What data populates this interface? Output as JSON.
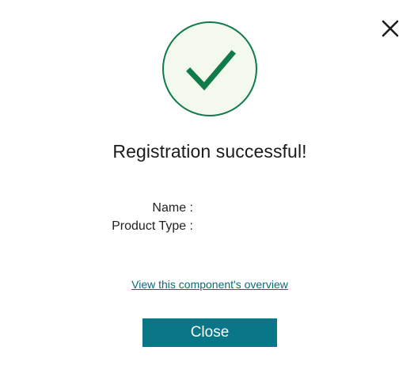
{
  "dialog": {
    "title": "Registration successful!",
    "fields": {
      "name_label": "Name :",
      "product_type_label": "Product Type :"
    },
    "overview_link": "View this component's overview",
    "close_button": "Close",
    "icons": {
      "close": "close-icon",
      "success": "checkmark-icon"
    },
    "colors": {
      "accent": "#0a7788",
      "success": "#0f7a4a",
      "success_bg": "#f3f9ec",
      "link": "#0b6b7a"
    }
  }
}
